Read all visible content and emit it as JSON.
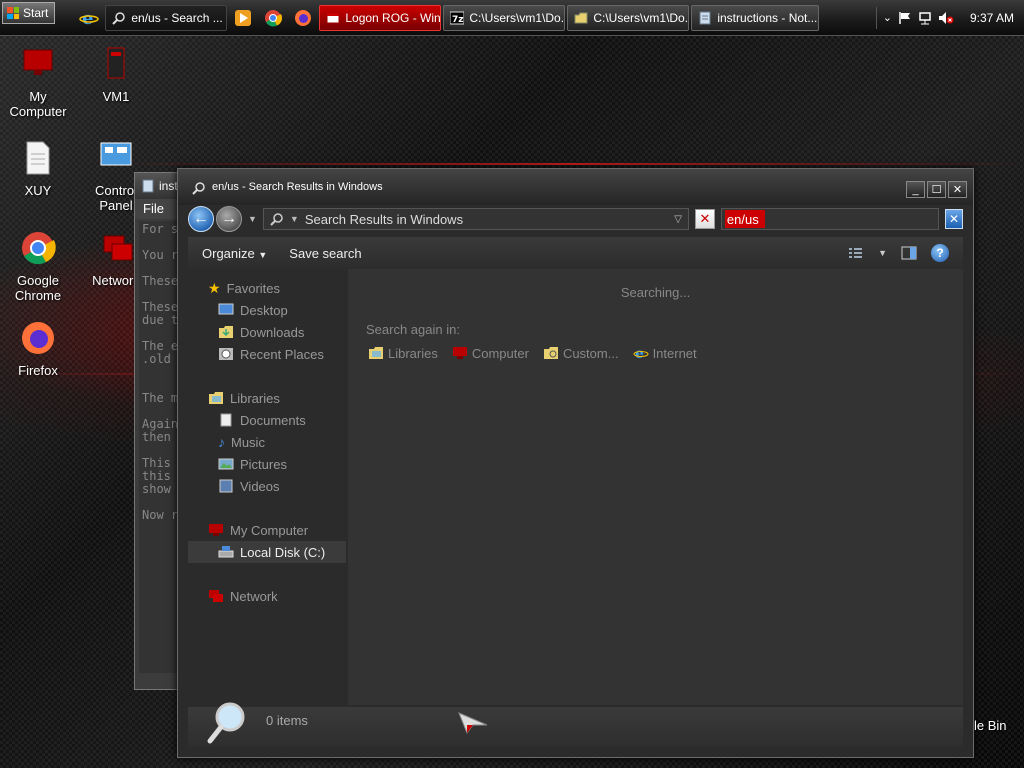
{
  "taskbar": {
    "start_label": "Start",
    "buttons": [
      {
        "label": "en/us - Search ...",
        "icon": "search-icon"
      },
      {
        "label": "Logon ROG - Win...",
        "icon": "window-icon"
      },
      {
        "label": "C:\\Users\\vm1\\Do...",
        "icon": "7zip-icon"
      },
      {
        "label": "C:\\Users\\vm1\\Do...",
        "icon": "folder-icon"
      },
      {
        "label": "instructions - Not...",
        "icon": "notepad-icon"
      }
    ],
    "clock": "9:37 AM"
  },
  "desktop": {
    "icons": [
      {
        "label": "My Computer"
      },
      {
        "label": "VM1"
      },
      {
        "label": "XUY"
      },
      {
        "label": "Control Panel"
      },
      {
        "label": "Google Chrome"
      },
      {
        "label": "Network"
      },
      {
        "label": "Firefox"
      }
    ],
    "recycle_bin_label": "le Bin"
  },
  "notepad": {
    "title": "inst",
    "menu_file": "File",
    "lines": [
      "For s",
      "",
      "You r",
      "",
      "These",
      "",
      "These",
      "due t",
      "",
      "The e",
      ".old",
      "",
      "",
      "The m",
      "",
      "Again",
      "then",
      "",
      "This",
      "this",
      "show",
      "",
      "Now r"
    ]
  },
  "explorer": {
    "title": "en/us - Search Results in Windows",
    "address": "Search Results in Windows",
    "search_value": "en/us",
    "toolbar": {
      "organize": "Organize",
      "save_search": "Save search"
    },
    "nav": {
      "favorites": "Favorites",
      "desktop": "Desktop",
      "downloads": "Downloads",
      "recent": "Recent Places",
      "libraries": "Libraries",
      "documents": "Documents",
      "music": "Music",
      "pictures": "Pictures",
      "videos": "Videos",
      "computer": "My Computer",
      "local_disk": "Local Disk (C:)",
      "network": "Network"
    },
    "content": {
      "status": "Searching...",
      "search_again": "Search again in:",
      "locations": [
        "Libraries",
        "Computer",
        "Custom...",
        "Internet"
      ]
    },
    "details": {
      "count": "0 items"
    }
  }
}
